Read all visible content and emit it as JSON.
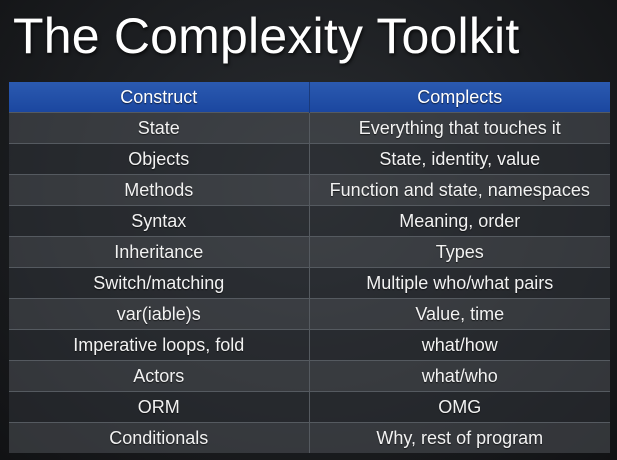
{
  "slide": {
    "title": "The Complexity Toolkit"
  },
  "table": {
    "headers": [
      "Construct",
      "Complects"
    ],
    "header_color": "#1f4ea6",
    "rows": [
      [
        "State",
        "Everything that touches it"
      ],
      [
        "Objects",
        "State, identity, value"
      ],
      [
        "Methods",
        "Function and state, namespaces"
      ],
      [
        "Syntax",
        "Meaning, order"
      ],
      [
        "Inheritance",
        "Types"
      ],
      [
        "Switch/matching",
        "Multiple who/what pairs"
      ],
      [
        "var(iable)s",
        "Value, time"
      ],
      [
        "Imperative loops, fold",
        "what/how"
      ],
      [
        "Actors",
        "what/who"
      ],
      [
        "ORM",
        "OMG"
      ],
      [
        "Conditionals",
        "Why, rest of program"
      ]
    ]
  }
}
